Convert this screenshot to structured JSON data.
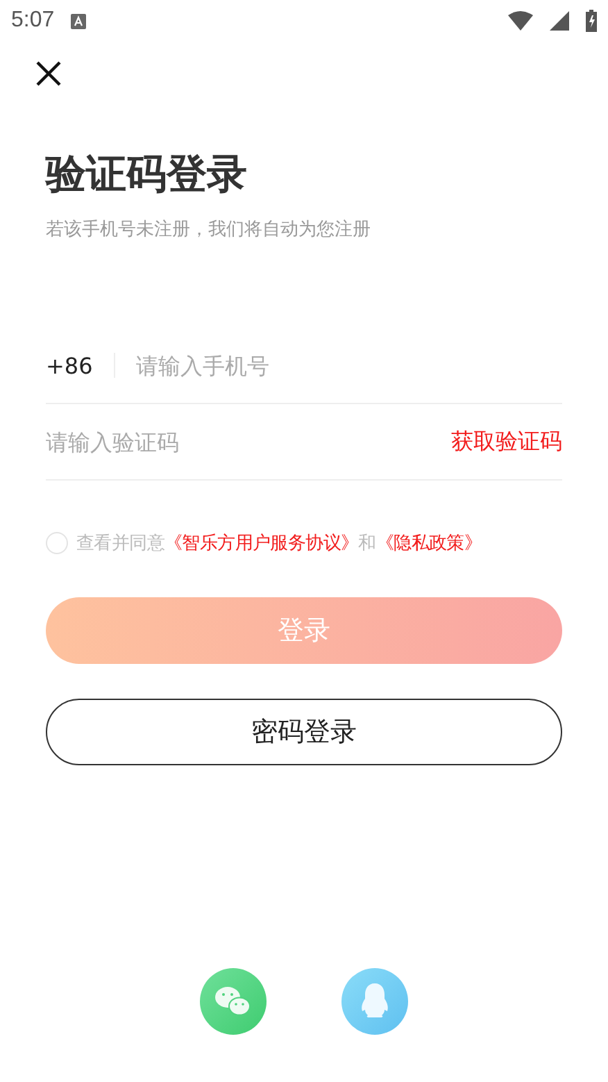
{
  "status_bar": {
    "time": "5:07"
  },
  "title": "验证码登录",
  "subtitle": "若该手机号未注册，我们将自动为您注册",
  "phone": {
    "country_code": "+86",
    "placeholder": "请输入手机号"
  },
  "code": {
    "placeholder": "请输入验证码",
    "action": "获取验证码"
  },
  "agreement": {
    "checked": false,
    "parts": [
      {
        "kind": "text",
        "text": "查看并同意"
      },
      {
        "kind": "link",
        "text": "《智乐方用户服务协议》"
      },
      {
        "kind": "text",
        "text": "和"
      },
      {
        "kind": "link",
        "text": "《隐私政策》"
      }
    ]
  },
  "login_button": {
    "label": "登录",
    "disabled": true
  },
  "password_button": {
    "label": "密码登录"
  }
}
